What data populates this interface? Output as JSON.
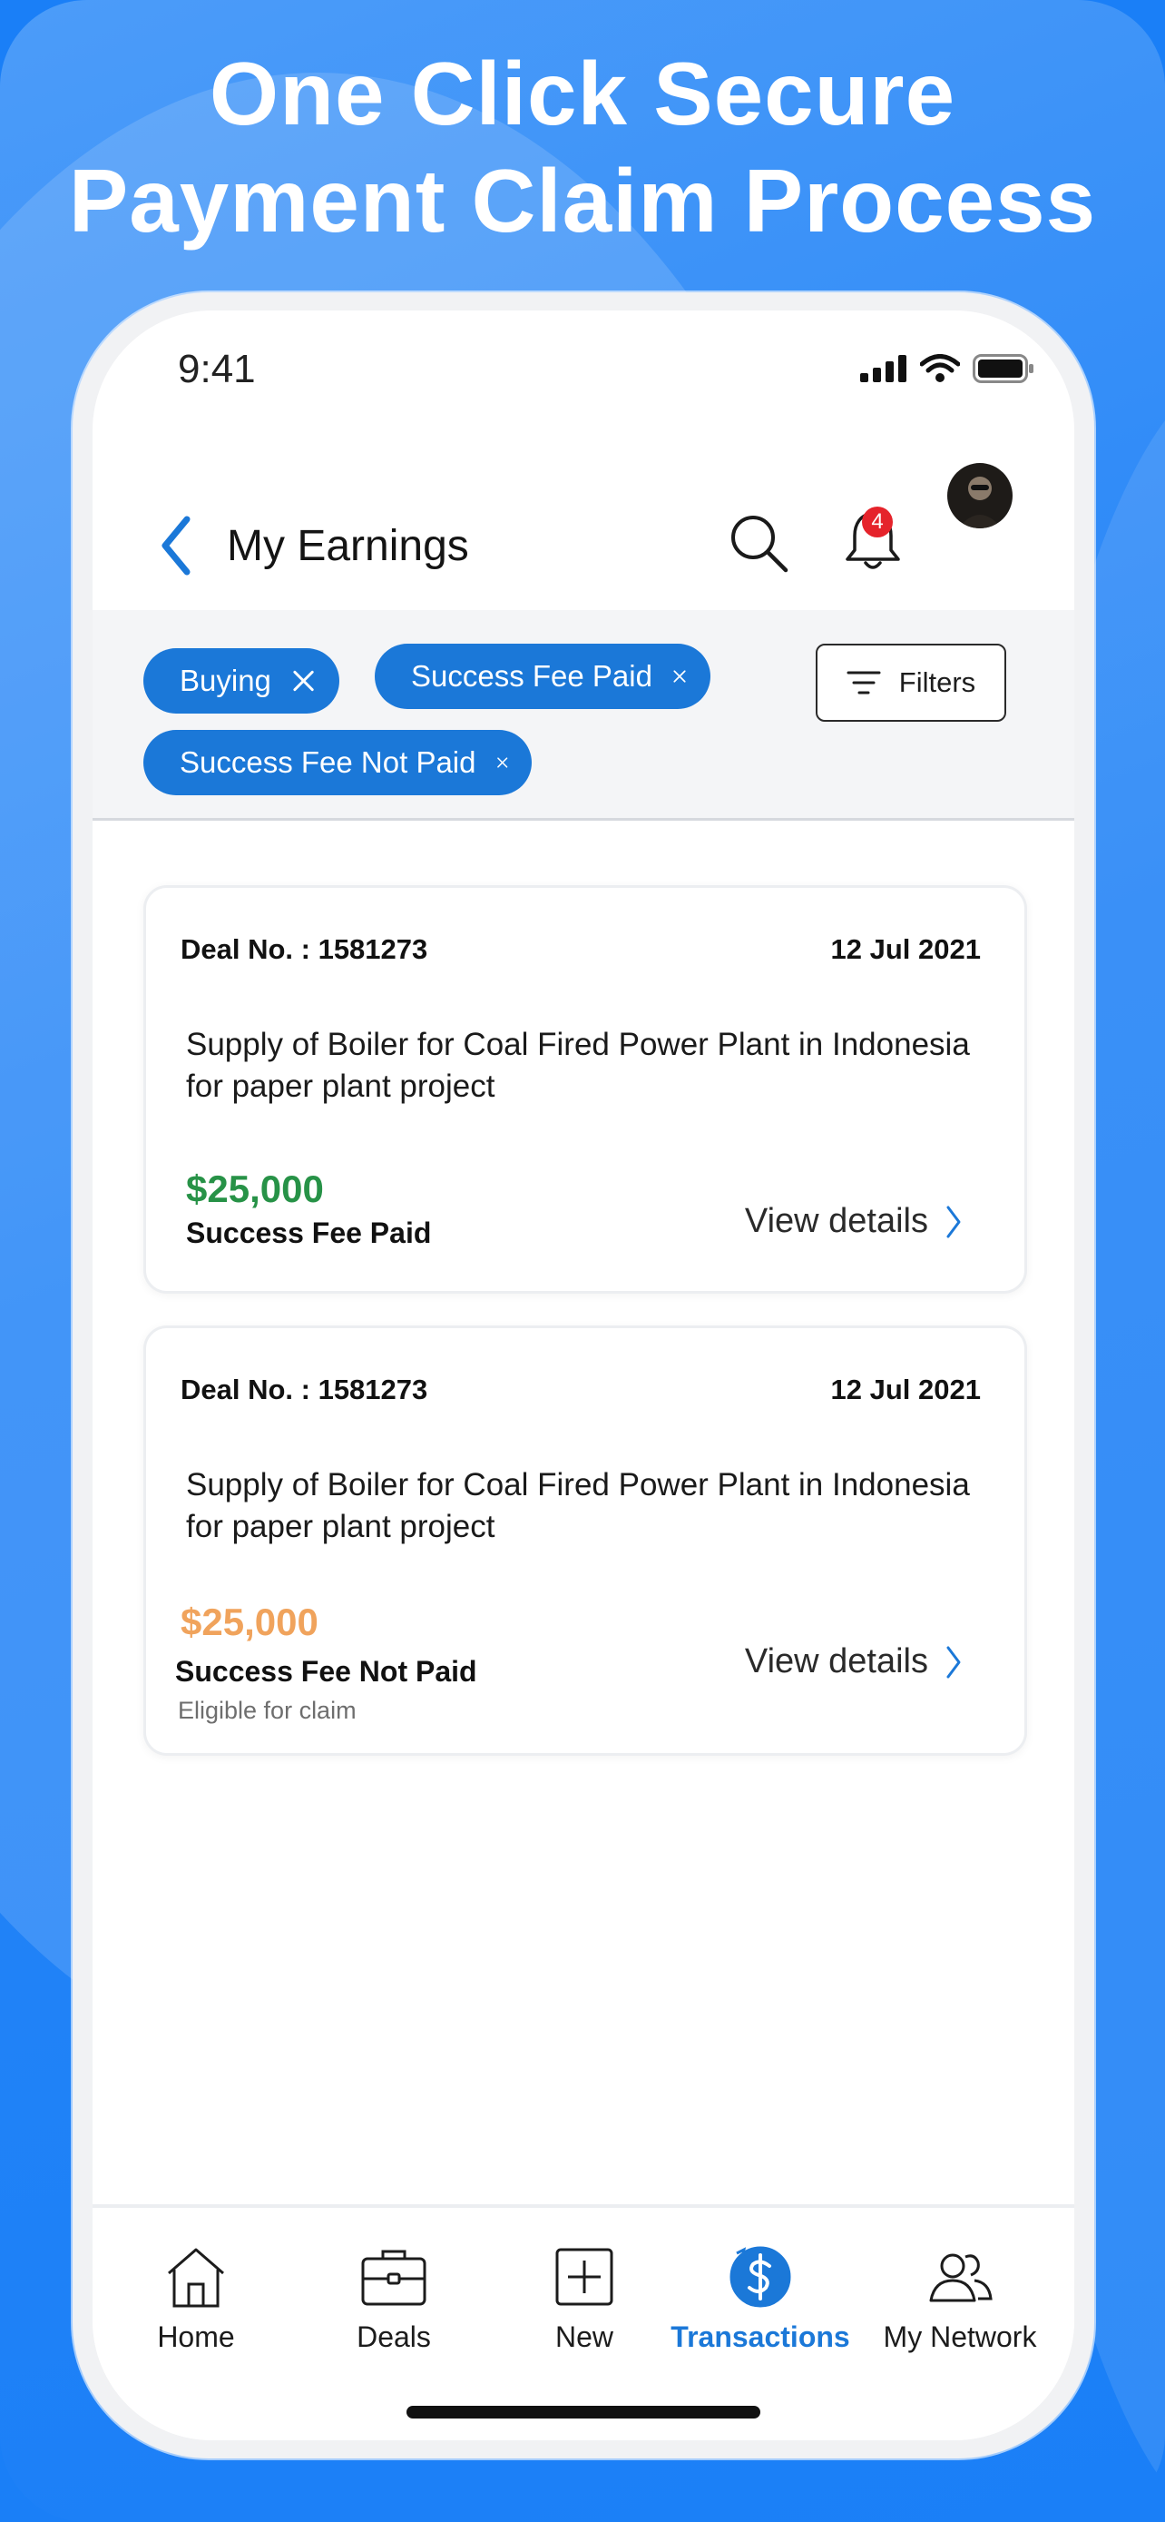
{
  "promo": {
    "headline_line1": "One Click Secure",
    "headline_line2": "Payment Claim Process"
  },
  "status_bar": {
    "time": "9:41"
  },
  "header": {
    "title": "My Earnings",
    "notification_count": "4"
  },
  "filters": {
    "chips": [
      {
        "label": "Buying"
      },
      {
        "label": "Success Fee Paid"
      },
      {
        "label": "Success Fee Not Paid"
      }
    ],
    "filters_button_label": "Filters"
  },
  "deals": [
    {
      "deal_no": "Deal No. : 1581273",
      "date": "12 Jul 2021",
      "description": "Supply of Boiler for Coal Fired Power Plant in Indonesia for paper plant project",
      "amount": "$25,000",
      "status": "Success Fee Paid",
      "note": "",
      "view_label": "View details"
    },
    {
      "deal_no": "Deal No. : 1581273",
      "date": "12 Jul 2021",
      "description": "Supply of Boiler for Coal Fired Power Plant in Indonesia for paper plant project",
      "amount": "$25,000",
      "status": "Success Fee Not Paid",
      "note": "Eligible for claim",
      "view_label": "View details"
    }
  ],
  "bottom_nav": {
    "items": [
      {
        "label": "Home",
        "icon": "home-icon"
      },
      {
        "label": "Deals",
        "icon": "briefcase-icon"
      },
      {
        "label": "New",
        "icon": "plus-square-icon"
      },
      {
        "label": "Transactions",
        "icon": "dollar-circle-icon",
        "active": true
      },
      {
        "label": "My Network",
        "icon": "people-icon"
      }
    ]
  },
  "colors": {
    "brand_blue": "#1b78d8",
    "paid_green": "#279247",
    "unpaid_orange": "#f0a35c",
    "badge_red": "#e5232b"
  }
}
